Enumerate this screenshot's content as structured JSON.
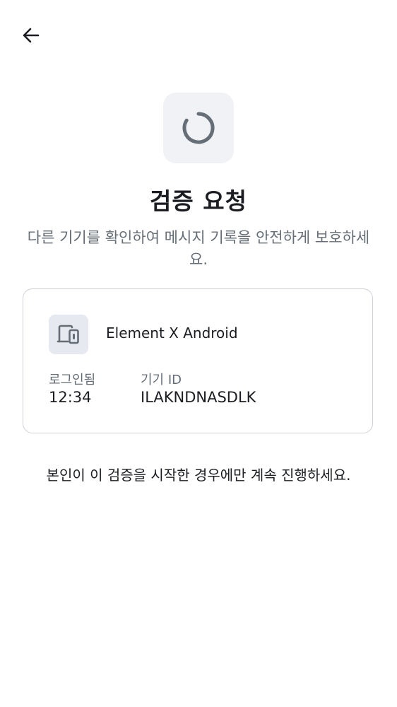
{
  "header": {
    "back_icon": "arrow-left-icon"
  },
  "hero": {
    "icon": "spinner-icon",
    "title": "검증 요청",
    "subtitle": "다른 기기를 확인하여 메시지 기록을 안전하게 보호하세요."
  },
  "device_card": {
    "icon": "devices-icon",
    "device_name": "Element X Android",
    "signed_in_label": "로그인됨",
    "signed_in_value": "12:34",
    "device_id_label": "기기 ID",
    "device_id_value": "ILAKNDNASDLK"
  },
  "footer": {
    "notice": "본인이 이 검증을 시작한 경우에만 계속 진행하세요."
  },
  "colors": {
    "background": "#ffffff",
    "text_primary": "#1b1d22",
    "text_secondary": "#656d77",
    "icon_tile": "#f0f2f5",
    "card_border": "#cdd1d6"
  }
}
